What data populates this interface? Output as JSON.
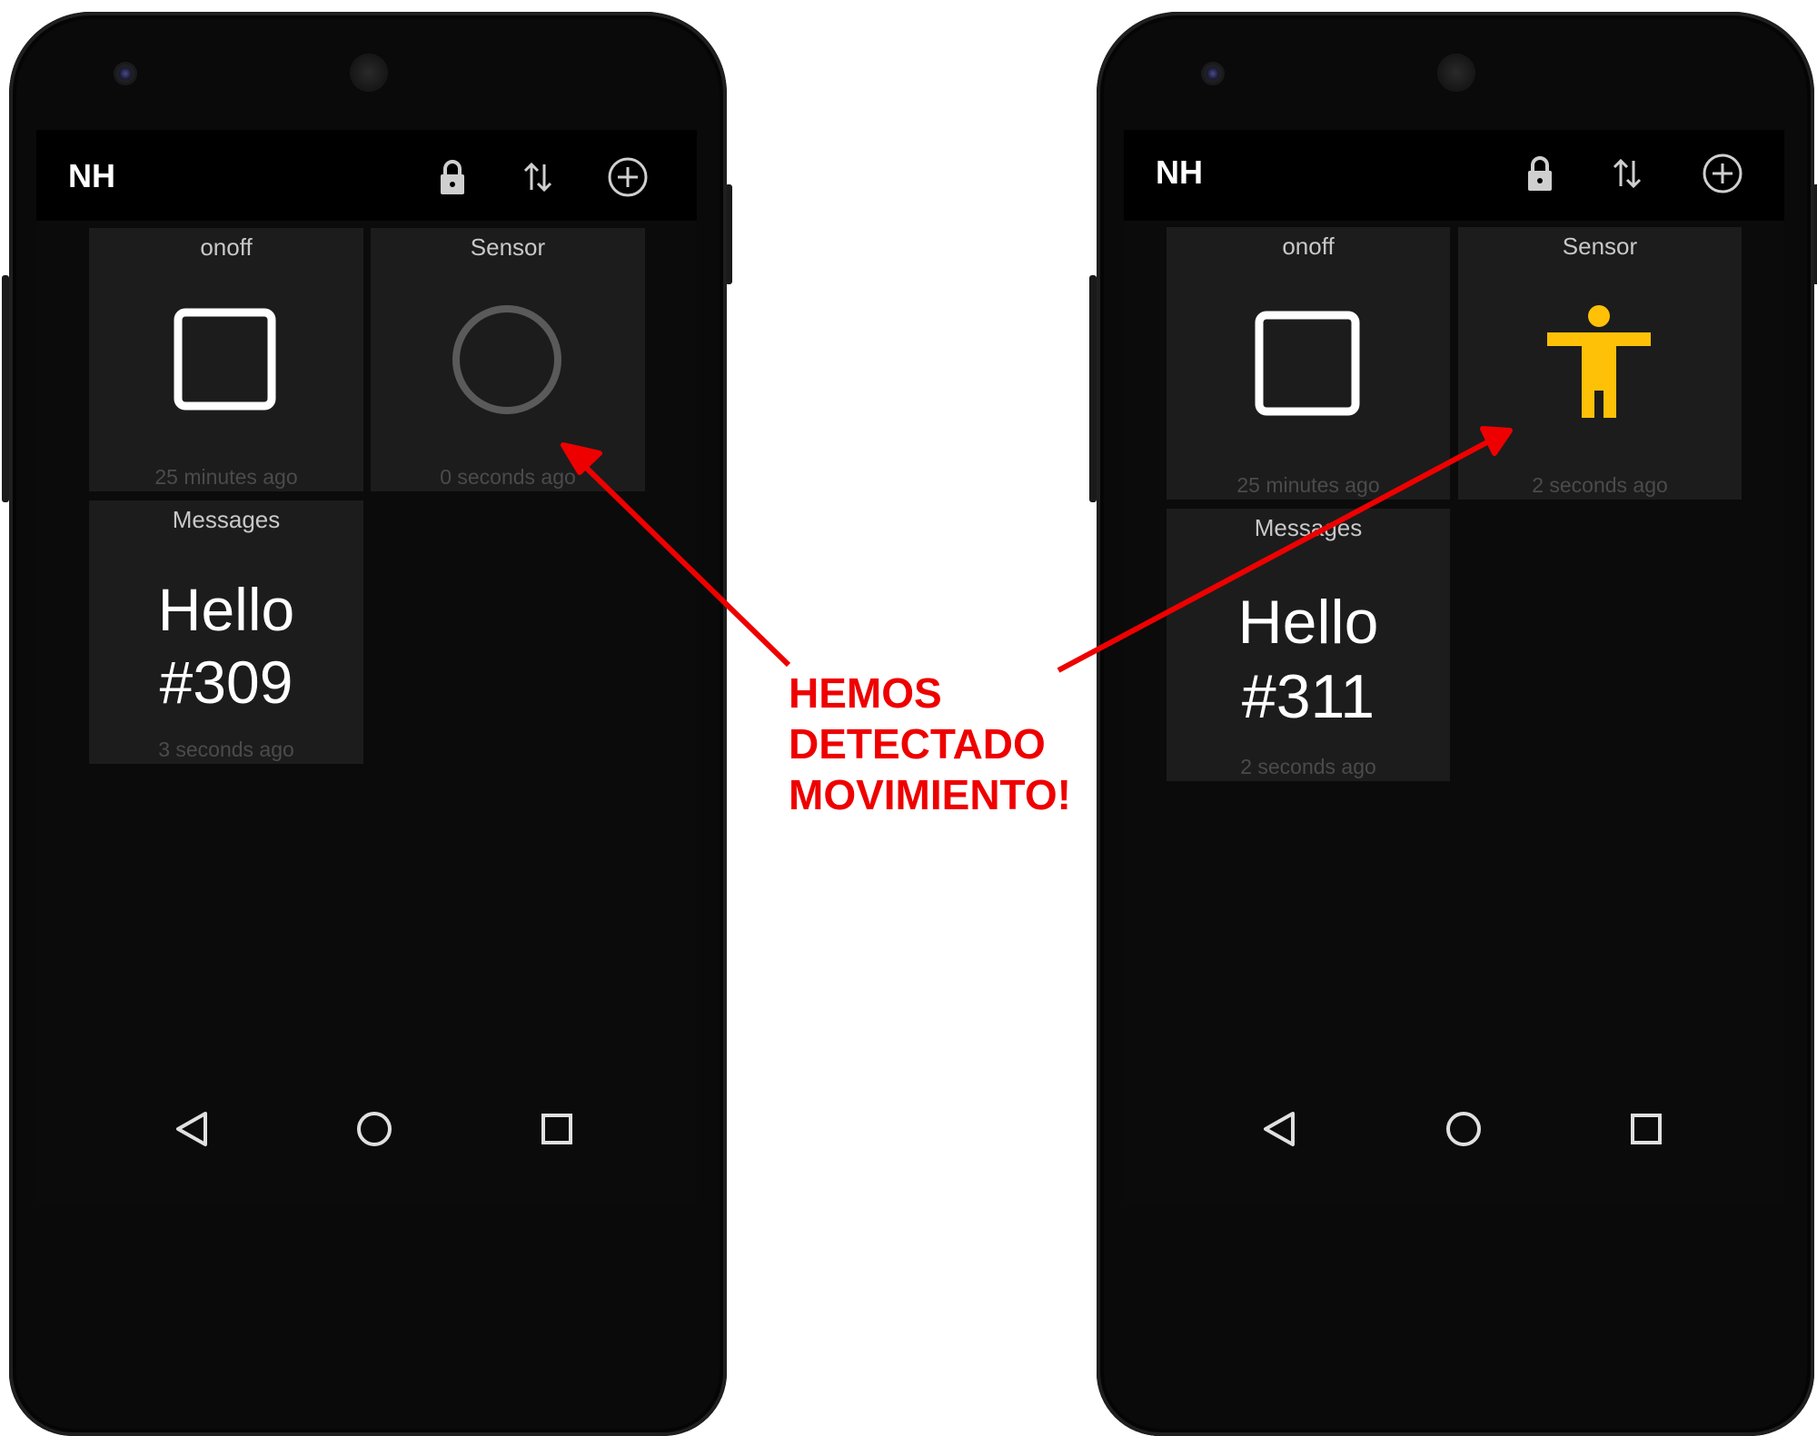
{
  "phones": [
    {
      "app_title": "NH",
      "tiles": {
        "onoff": {
          "title": "onoff",
          "time": "25 minutes ago",
          "state": "off"
        },
        "sensor": {
          "title": "Sensor",
          "time": "0 seconds ago",
          "state": "no-motion"
        },
        "messages": {
          "title": "Messages",
          "line1": "Hello",
          "line2": "#309",
          "time": "3 seconds ago"
        }
      }
    },
    {
      "app_title": "NH",
      "tiles": {
        "onoff": {
          "title": "onoff",
          "time": "25 minutes ago",
          "state": "off"
        },
        "sensor": {
          "title": "Sensor",
          "time": "2 seconds ago",
          "state": "motion-detected"
        },
        "messages": {
          "title": "Messages",
          "line1": "Hello",
          "line2": "#311",
          "time": "2 seconds ago"
        }
      }
    }
  ],
  "toolbar_icons": [
    "lock-icon",
    "swap-vertical-icon",
    "add-circle-icon"
  ],
  "nav_icons": [
    "back-icon",
    "home-icon",
    "recents-icon"
  ],
  "callout": {
    "lines": [
      "HEMOS",
      "DETECTADO",
      "MOVIMIENTO!"
    ],
    "color": "#ee0000"
  },
  "colors": {
    "motion_icon": "#ffc107",
    "idle_ring": "#5a5a5a",
    "tile_bg": "#1c1c1c"
  }
}
